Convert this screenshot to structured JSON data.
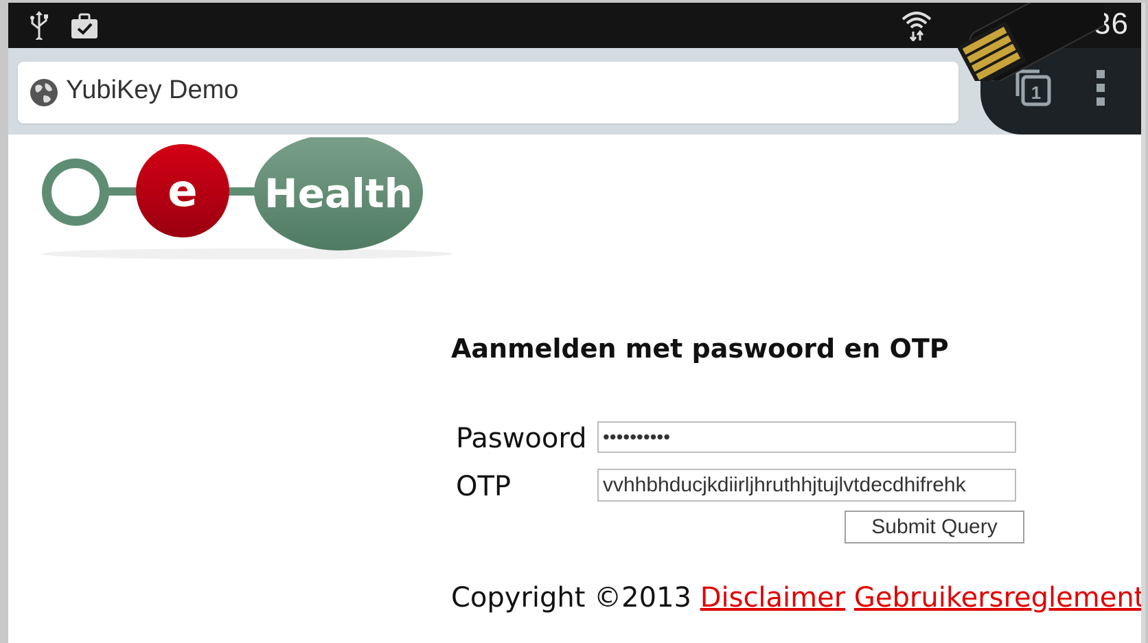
{
  "status_bar": {
    "icons": [
      "usb-icon",
      "briefcase-check-icon",
      "wifi-icon"
    ],
    "time_visible": ":36"
  },
  "browser": {
    "page_title": "YubiKey Demo",
    "tab_count": "1",
    "icons": [
      "globe-icon",
      "tabs-icon",
      "overflow-menu-icon"
    ]
  },
  "logo": {
    "text_e": "e",
    "text_health": "Health",
    "colors": {
      "green": "#5e8d74",
      "red": "#c00010"
    }
  },
  "login": {
    "heading": "Aanmelden met paswoord en OTP",
    "password_label": "Paswoord",
    "password_value": "••••••••••",
    "otp_label": "OTP",
    "otp_value": "vvhhbhducjkdiirljhruthhjtujlvtdecdhifrehk",
    "submit_label": "Submit Query"
  },
  "footer": {
    "copyright": "Copyright ©2013",
    "disclaimer": "Disclaimer",
    "terms": "Gebruikersreglement",
    "link_color": "#e00000"
  }
}
